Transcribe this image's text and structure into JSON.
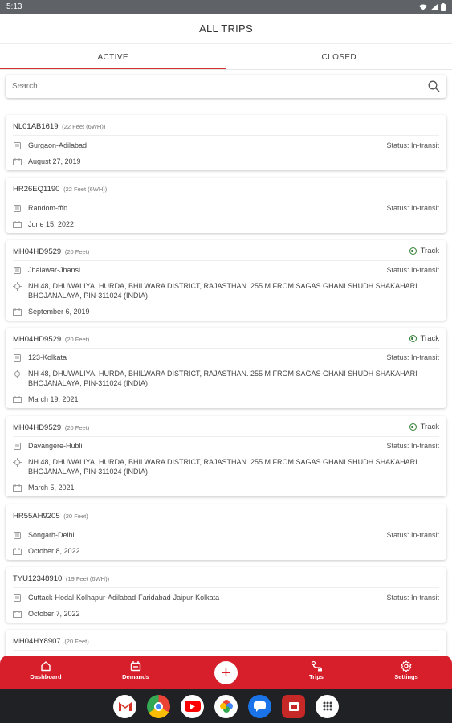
{
  "status_bar": {
    "time": "5:13"
  },
  "header": {
    "title": "ALL TRIPS"
  },
  "tabs": [
    {
      "label": "ACTIVE"
    },
    {
      "label": "CLOSED"
    }
  ],
  "search": {
    "placeholder": "Search"
  },
  "trips": [
    {
      "vehicle": "NL01AB1619",
      "size": "(22 Feet (6WH))",
      "route": "Gurgaon-Adilabad",
      "status": "Status: In-transit",
      "date": "August 27, 2019"
    },
    {
      "vehicle": "HR26EQ1190",
      "size": "(22 Feet (6WH))",
      "route": "Random-fffd",
      "status": "Status: In-transit",
      "date": "June 15, 2022"
    },
    {
      "vehicle": "MH04HD9529",
      "size": "(20 Feet)",
      "track": "Track",
      "route": "Jhalawar-Jhansi",
      "status": "Status: In-transit",
      "address": "NH 48, DHUWALIYA, HURDA, BHILWARA DISTRICT, RAJASTHAN. 255 M FROM SAGAS GHANI SHUDH SHAKAHARI BHOJANALAYA, PIN-311024 (INDIA)",
      "date": "September 6, 2019"
    },
    {
      "vehicle": "MH04HD9529",
      "size": "(20 Feet)",
      "track": "Track",
      "route": "123-Kolkata",
      "status": "Status: In-transit",
      "address": "NH 48, DHUWALIYA, HURDA, BHILWARA DISTRICT, RAJASTHAN. 255 M FROM SAGAS GHANI SHUDH SHAKAHARI BHOJANALAYA, PIN-311024 (INDIA)",
      "date": "March 19, 2021"
    },
    {
      "vehicle": "MH04HD9529",
      "size": "(20 Feet)",
      "track": "Track",
      "route": "Davangere-Hubli",
      "status": "Status: In-transit",
      "address": "NH 48, DHUWALIYA, HURDA, BHILWARA DISTRICT, RAJASTHAN. 255 M FROM SAGAS GHANI SHUDH SHAKAHARI BHOJANALAYA, PIN-311024 (INDIA)",
      "date": "March 5, 2021"
    },
    {
      "vehicle": "HR55AH9205",
      "size": "(20 Feet)",
      "route": "Songarh-Delhi",
      "status": "Status: In-transit",
      "date": "October 8, 2022"
    },
    {
      "vehicle": "TYU12348910",
      "size": "(19 Feet (6WH))",
      "route": "Cuttack-Hodal-Kolhapur-Adilabad-Faridabad-Jaipur-Kolkata",
      "status": "Status: In-transit",
      "date": "October 7, 2022"
    },
    {
      "vehicle": "MH04HY8907",
      "size": "(20 Feet)"
    }
  ],
  "bottom_nav": [
    {
      "label": "Dashboard",
      "icon": "home-icon"
    },
    {
      "label": "Demands",
      "icon": "demands-icon"
    },
    {
      "label": "+",
      "icon": "add-icon"
    },
    {
      "label": "Trips",
      "icon": "trips-icon"
    },
    {
      "label": "Settings",
      "icon": "settings-icon"
    }
  ],
  "dock_apps": [
    {
      "icon": "gmail-icon"
    },
    {
      "icon": "chrome-icon"
    },
    {
      "icon": "youtube-icon"
    },
    {
      "icon": "photos-icon"
    },
    {
      "icon": "messages-icon"
    },
    {
      "icon": "app-icon"
    },
    {
      "icon": "app-drawer-icon"
    }
  ],
  "colors": {
    "accent": "#d71f2b",
    "track_green": "#2e7d32"
  }
}
